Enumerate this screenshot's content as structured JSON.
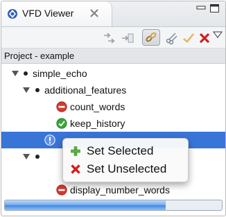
{
  "window": {
    "tab_title": "VFD Viewer",
    "icons": {
      "tab": "vfd-viewer-icon",
      "close": "close-tab-icon",
      "minimize": "minimize-icon",
      "maximize": "maximize-icon"
    }
  },
  "toolbar": {
    "buttons": [
      {
        "name": "expand-tree-button",
        "icon": "expand-arrows-icon",
        "enabled": false
      },
      {
        "name": "collapse-tree-button",
        "icon": "collapse-arrows-icon",
        "enabled": false
      },
      {
        "name": "link-button",
        "icon": "link-chain-icon",
        "pressed": true
      },
      {
        "name": "cut-button",
        "icon": "scissors-icon"
      },
      {
        "name": "check-button",
        "icon": "checkmark-icon"
      },
      {
        "name": "delete-button",
        "icon": "red-x-icon"
      },
      {
        "name": "view-menu-button",
        "icon": "triangle-down-icon"
      }
    ]
  },
  "project": {
    "label": "Project - example"
  },
  "tree": {
    "nodes": [
      {
        "label": "simple_echo",
        "type": "feature",
        "expanded": true
      },
      {
        "label": "additional_features",
        "type": "feature",
        "expanded": true
      },
      {
        "label": "count_words",
        "type": "leaf",
        "status": "unselected",
        "icon": "red-minus-icon"
      },
      {
        "label": "keep_history",
        "type": "leaf",
        "status": "selected",
        "icon": "green-check-icon"
      },
      {
        "label": "display_number_words",
        "type": "leaf",
        "status": "unselected",
        "icon": "red-minus-icon"
      }
    ]
  },
  "context_menu": {
    "items": [
      {
        "label": "Set Selected",
        "icon": "green-plus-icon"
      },
      {
        "label": "Set Unselected",
        "icon": "red-x-icon"
      }
    ]
  },
  "progress": {
    "value": 0.74
  },
  "colors": {
    "selection": "#3875d7",
    "progress": "#3f86e3",
    "unselected": "#d33a2c",
    "selected": "#3aa63a"
  }
}
